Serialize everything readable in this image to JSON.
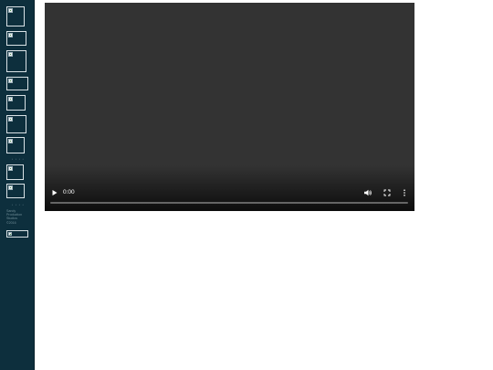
{
  "sidebar": {
    "nav_images": [
      {
        "name": "nav-image-1"
      },
      {
        "name": "nav-image-2"
      },
      {
        "name": "nav-image-3"
      },
      {
        "name": "nav-image-4"
      },
      {
        "name": "nav-image-5"
      },
      {
        "name": "nav-image-6"
      },
      {
        "name": "nav-image-7"
      },
      {
        "name": "nav-image-8"
      },
      {
        "name": "nav-image-9"
      },
      {
        "name": "nav-image-10"
      }
    ],
    "separator_1": "• • • •",
    "separator_2": "• • • •",
    "credit_lines": [
      "Sandy",
      "Production",
      "Studios",
      "©2016"
    ]
  },
  "video": {
    "current_time": "0:00",
    "progress_fraction": 0,
    "icons": {
      "play": "play-icon",
      "volume": "volume-icon",
      "fullscreen": "fullscreen-icon",
      "more": "more-options-icon"
    },
    "colors": {
      "background": "#333333",
      "controls": "#ffffff"
    }
  }
}
